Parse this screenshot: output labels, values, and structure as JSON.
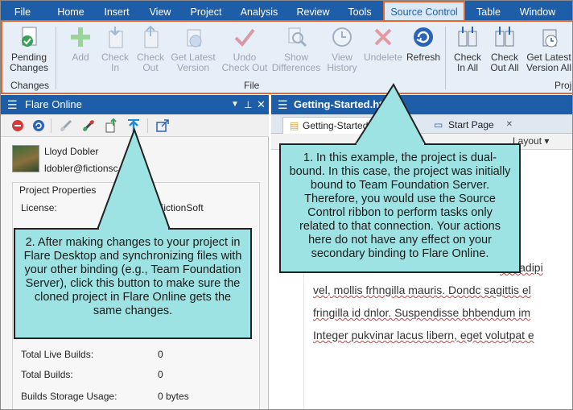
{
  "ribbon": {
    "tabs": [
      {
        "label": "File"
      },
      {
        "label": "Home"
      },
      {
        "label": "Insert"
      },
      {
        "label": "View"
      },
      {
        "label": "Project"
      },
      {
        "label": "Analysis"
      },
      {
        "label": "Review"
      },
      {
        "label": "Tools"
      },
      {
        "label": "Source Control"
      },
      {
        "label": "Table"
      },
      {
        "label": "Window"
      }
    ],
    "active_tab": "Source Control",
    "buttons": {
      "pending": "Pending Changes",
      "add": "Add",
      "checkin": "Check In",
      "checkout": "Check Out",
      "getlatest": "Get Latest Version",
      "undocheckout": "Undo Check Out",
      "showdiff": "Show Differences",
      "viewhistory": "View History",
      "undelete": "Undelete",
      "refresh": "Refresh",
      "checkinall": "Check In All",
      "checkoutall": "Check Out All",
      "getlatestall": "Get Latest Version All"
    },
    "groups": {
      "changes": "Changes",
      "file": "File",
      "project": "Proje"
    }
  },
  "panel": {
    "title": "Flare Online",
    "user_name": "Lloyd Dobler",
    "user_email": "ldobler@fictionsc",
    "props_heading": "Project Properties",
    "rows": [
      {
        "label": "License:",
        "value": "FictionSoft"
      },
      {
        "label": "Total Live Builds:",
        "value": "0"
      },
      {
        "label": "Total Builds:",
        "value": "0"
      },
      {
        "label": "Builds Storage Usage:",
        "value": "0 bytes"
      }
    ]
  },
  "editor": {
    "title": "Getting-Started.htm",
    "tabs": [
      {
        "label": "Getting-Started"
      },
      {
        "label": "Start Page"
      }
    ],
    "layout_label": "Layout",
    "text_lines": [
      "ettr adipi",
      "vel, mollis frhngilla mauris. Dondc sagittis el",
      "fringilla id dnlor. Suspendisse bhbendum im",
      "Integer pukvinar lacus libern, eget volutpat e"
    ]
  },
  "callouts": {
    "one": "1. In this example, the project is dual-bound. In this case, the project was initially bound to Team Foundation Server. Therefore, you would use the Source Control ribbon to perform tasks only related to that connection. Your actions here do not have any effect on your secondary binding to Flare Online.",
    "two": "2. After making changes to your project in Flare Desktop and synchronizing files with your other binding (e.g., Team Foundation Server), click this button to make sure the cloned project in Flare Online gets the same changes."
  },
  "colors": {
    "accent": "#1e5da8",
    "highlight": "#e2672c",
    "callout": "#9ee3e3"
  }
}
